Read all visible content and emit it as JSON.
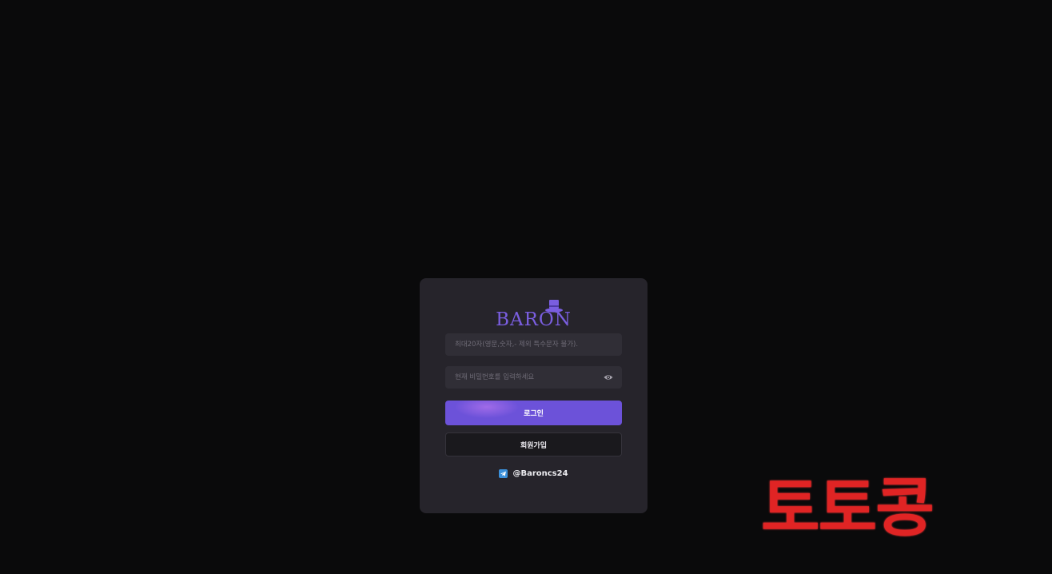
{
  "brand": {
    "logo_text": "BARON",
    "accent_color": "#7a5ee0"
  },
  "login_form": {
    "username_placeholder": "최대20자(영문,숫자,- 제외 특수문자 불가).",
    "password_placeholder": "현재 비밀번호를 입력하세요",
    "password_toggle_icon": "eye-icon",
    "login_label": "로그인",
    "signup_label": "회원가입"
  },
  "contact": {
    "icon": "telegram-icon",
    "handle": "@Baroncs24"
  },
  "watermark": {
    "text": "토토콩",
    "color": "#e02424"
  }
}
